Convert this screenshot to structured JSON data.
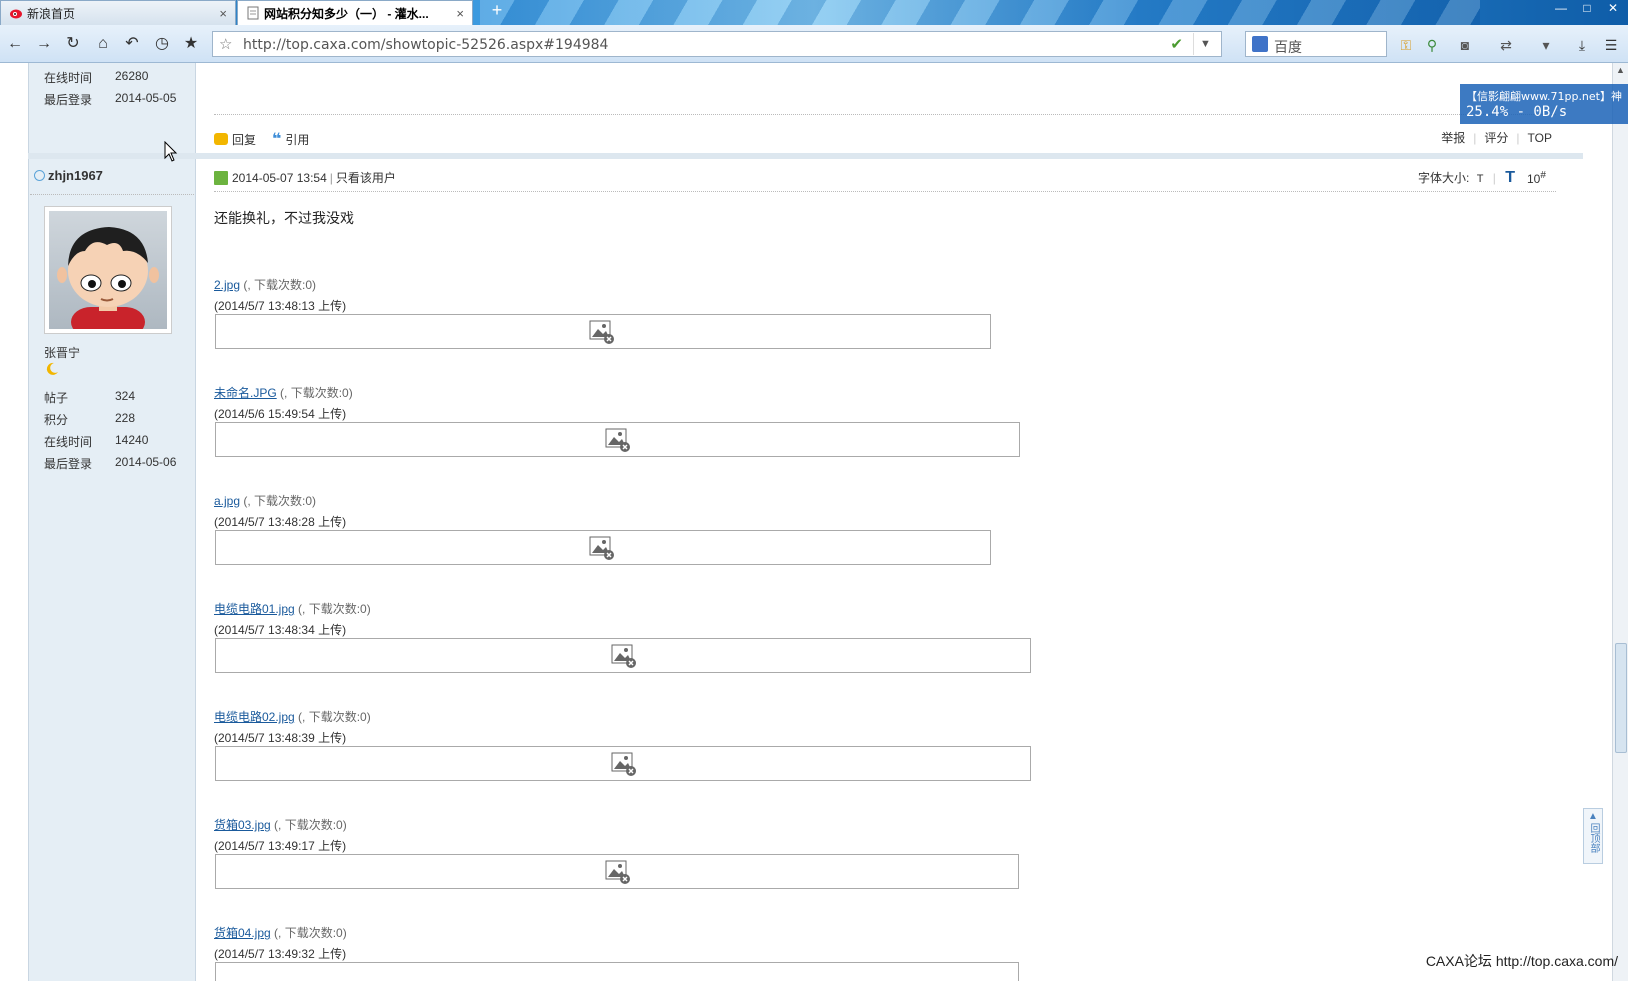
{
  "browser": {
    "tabs": [
      {
        "label": "新浪首页",
        "close": "×"
      },
      {
        "label": "网站积分知多少（一） - 灌水...",
        "close": "×"
      }
    ],
    "new_tab": "+",
    "window_controls": [
      "—",
      "□",
      "✕"
    ],
    "url": "http://top.caxa.com/showtopic-52526.aspx#194984",
    "search_placeholder": "百度"
  },
  "previous_user": {
    "stats": [
      {
        "label": "在线时间",
        "value": "26280"
      },
      {
        "label": "最后登录",
        "value": "2014-05-05"
      }
    ]
  },
  "previous_post_actions": {
    "reply": "回复",
    "quote": "引用",
    "report": "举报",
    "rate": "评分",
    "top": "TOP"
  },
  "user": {
    "name": "zhjn1967",
    "real_name": "张晋宁",
    "stats": [
      {
        "label": "帖子",
        "value": "324"
      },
      {
        "label": "积分",
        "value": "228"
      },
      {
        "label": "在线时间",
        "value": "14240"
      },
      {
        "label": "最后登录",
        "value": "2014-05-06"
      }
    ]
  },
  "post": {
    "datetime": "2014-05-07 13:54",
    "only_user": "只看该用户",
    "font_size_label": "字体大小:",
    "font_small": "T",
    "font_large": "T",
    "floor": "10",
    "floor_mark": "#",
    "text": "还能换礼，不过我没戏",
    "attachments": [
      {
        "name": "2.jpg",
        "count": "(, 下载次数:0)",
        "date": "(2014/5/7 13:48:13 上传)"
      },
      {
        "name": "未命名.JPG",
        "count": "(, 下载次数:0)",
        "date": "(2014/5/6 15:49:54 上传)"
      },
      {
        "name": "a.jpg",
        "count": "(, 下载次数:0)",
        "date": "(2014/5/7 13:48:28 上传)"
      },
      {
        "name": "电缆电路01.jpg",
        "count": "(, 下载次数:0)",
        "date": "(2014/5/7 13:48:34 上传)"
      },
      {
        "name": "电缆电路02.jpg",
        "count": "(, 下载次数:0)",
        "date": "(2014/5/7 13:48:39 上传)"
      },
      {
        "name": "货箱03.jpg",
        "count": "(, 下载次数:0)",
        "date": "(2014/5/7 13:49:17 上传)"
      },
      {
        "name": "货箱04.jpg",
        "count": "(, 下载次数:0)",
        "date": "(2014/5/7 13:49:32 上传)"
      }
    ]
  },
  "overlay": {
    "line1": "【信影翩翩www.71pp.net】神",
    "line2": "25.4% - 0B/s"
  },
  "back_to_top": "回顶部",
  "footer": "CAXA论坛 http://top.caxa.com/",
  "colors": {
    "link": "#1a5a9c",
    "sidebar_bg": "#e5eef5",
    "accent": "#1c63b8"
  }
}
